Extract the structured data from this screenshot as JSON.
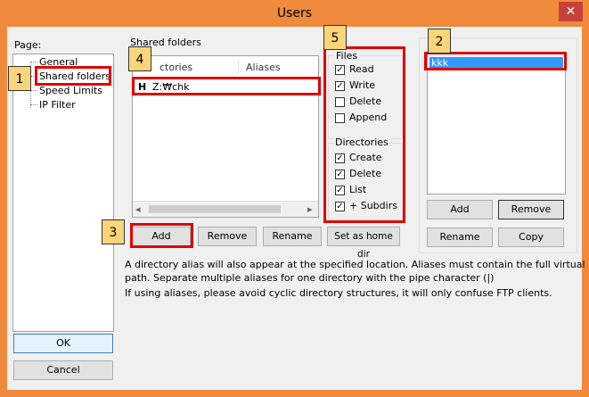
{
  "window": {
    "title": "Users",
    "close_glyph": "✕"
  },
  "page_panel": {
    "label": "Page:",
    "items": [
      {
        "label": "General"
      },
      {
        "label": "Shared folders"
      },
      {
        "label": "Speed Limits"
      },
      {
        "label": "IP Filter"
      }
    ]
  },
  "shared": {
    "group_label": "Shared folders",
    "columns": [
      "Directories",
      "Aliases"
    ],
    "visible_column0": "ctories",
    "rows": [
      {
        "flag": "H",
        "path": "Z:₩chk"
      }
    ],
    "buttons": {
      "add": "Add",
      "remove": "Remove",
      "rename": "Rename",
      "home": "Set as home dir"
    }
  },
  "files": {
    "label": "Files",
    "items": [
      {
        "label": "Read",
        "checked": true,
        "mark": "✓"
      },
      {
        "label": "Write",
        "checked": true,
        "mark": "✓"
      },
      {
        "label": "Delete",
        "checked": false,
        "mark": ""
      },
      {
        "label": "Append",
        "checked": false,
        "mark": ""
      }
    ]
  },
  "directories": {
    "label": "Directories",
    "items": [
      {
        "label": "Create",
        "checked": true,
        "mark": "✓"
      },
      {
        "label": "Delete",
        "checked": true,
        "mark": "✓"
      },
      {
        "label": "List",
        "checked": true,
        "mark": "✓"
      },
      {
        "label": "+ Subdirs",
        "checked": true,
        "mark": "✓"
      }
    ]
  },
  "users": {
    "items": [
      "kkk"
    ],
    "buttons": {
      "add": "Add",
      "remove": "Remove",
      "rename": "Rename",
      "copy": "Copy"
    }
  },
  "notes": {
    "line1": "A directory alias will also appear at the specified location. Aliases must contain the full virtual",
    "line2": "path. Separate multiple aliases for one directory with the pipe character (|)",
    "line3": "If using aliases, please avoid cyclic directory structures, it will only confuse FTP clients."
  },
  "footer": {
    "ok": "OK",
    "cancel": "Cancel"
  },
  "callouts": [
    "1",
    "2",
    "3",
    "4",
    "5"
  ],
  "scroll": {
    "left_arrow": "◂",
    "right_arrow": "▸"
  }
}
